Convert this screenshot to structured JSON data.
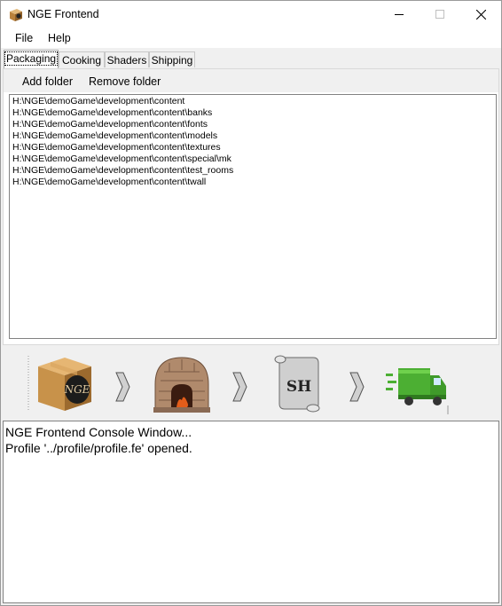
{
  "window": {
    "title": "NGE Frontend"
  },
  "menu": {
    "file": "File",
    "help": "Help"
  },
  "tabs": [
    {
      "label": "Packaging",
      "active": true
    },
    {
      "label": "Cooking"
    },
    {
      "label": "Shaders"
    },
    {
      "label": "Shipping"
    }
  ],
  "toolbar": {
    "add_folder": "Add folder",
    "remove_folder": "Remove folder"
  },
  "folders": [
    "H:\\NGE\\demoGame\\development\\content",
    "H:\\NGE\\demoGame\\development\\content\\banks",
    "H:\\NGE\\demoGame\\development\\content\\fonts",
    "H:\\NGE\\demoGame\\development\\content\\models",
    "H:\\NGE\\demoGame\\development\\content\\textures",
    "H:\\NGE\\demoGame\\development\\content\\special\\mk",
    "H:\\NGE\\demoGame\\development\\content\\test_rooms",
    "H:\\NGE\\demoGame\\development\\content\\twall"
  ],
  "pipeline": {
    "stages": [
      "package-box-icon",
      "oven-icon",
      "shader-scroll-icon",
      "delivery-truck-icon"
    ],
    "box_logo": "NGE",
    "scroll_label": "SH"
  },
  "console": {
    "lines": [
      "NGE Frontend Console Window...",
      "Profile '../profile/profile.fe' opened."
    ]
  },
  "colors": {
    "truck_green": "#4caf33",
    "oven_brick": "#b08a6c",
    "box_brown": "#c8924a"
  }
}
